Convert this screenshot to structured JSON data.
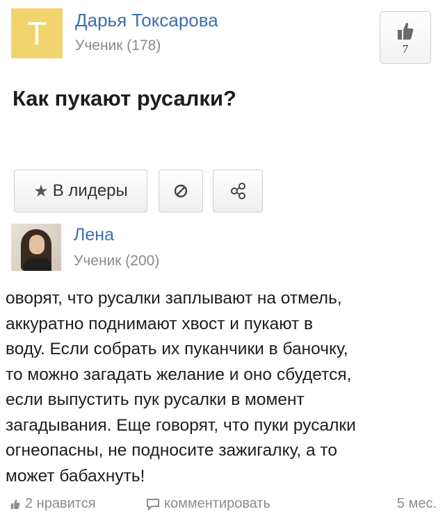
{
  "question": {
    "avatar_letter": "T",
    "author_name": "Дарья Токсарова",
    "author_status": "Ученик (178)",
    "like_count": "7",
    "title": "Как пукают русалки?"
  },
  "actions": {
    "leaders_label": "В лидеры"
  },
  "answer": {
    "author_name": "Лена",
    "author_status": "Ученик (200)",
    "text": "оворят, что русалки заплывают на отмель,\nаккуратно поднимают хвост и пукают в\nводу. Если собрать их пуканчики в баночку,\nто можно загадать желание и оно сбудется,\nесли выпустить пук русалки в момент\nзагадывания. Еще говорят, что пуки русалки\nогнеопасны, не подносите зажигалку, а то\nможет бабахнуть!"
  },
  "footer": {
    "likes_label": "2 нравится",
    "comment_label": "комментировать",
    "age_label": "5 мес."
  },
  "colors": {
    "link": "#3b6fb0",
    "avatar_bg": "#f2d46f",
    "muted": "#8a8a8a"
  },
  "icons": [
    "thumbs-up-icon",
    "star-icon",
    "block-icon",
    "share-icon",
    "comment-icon"
  ]
}
